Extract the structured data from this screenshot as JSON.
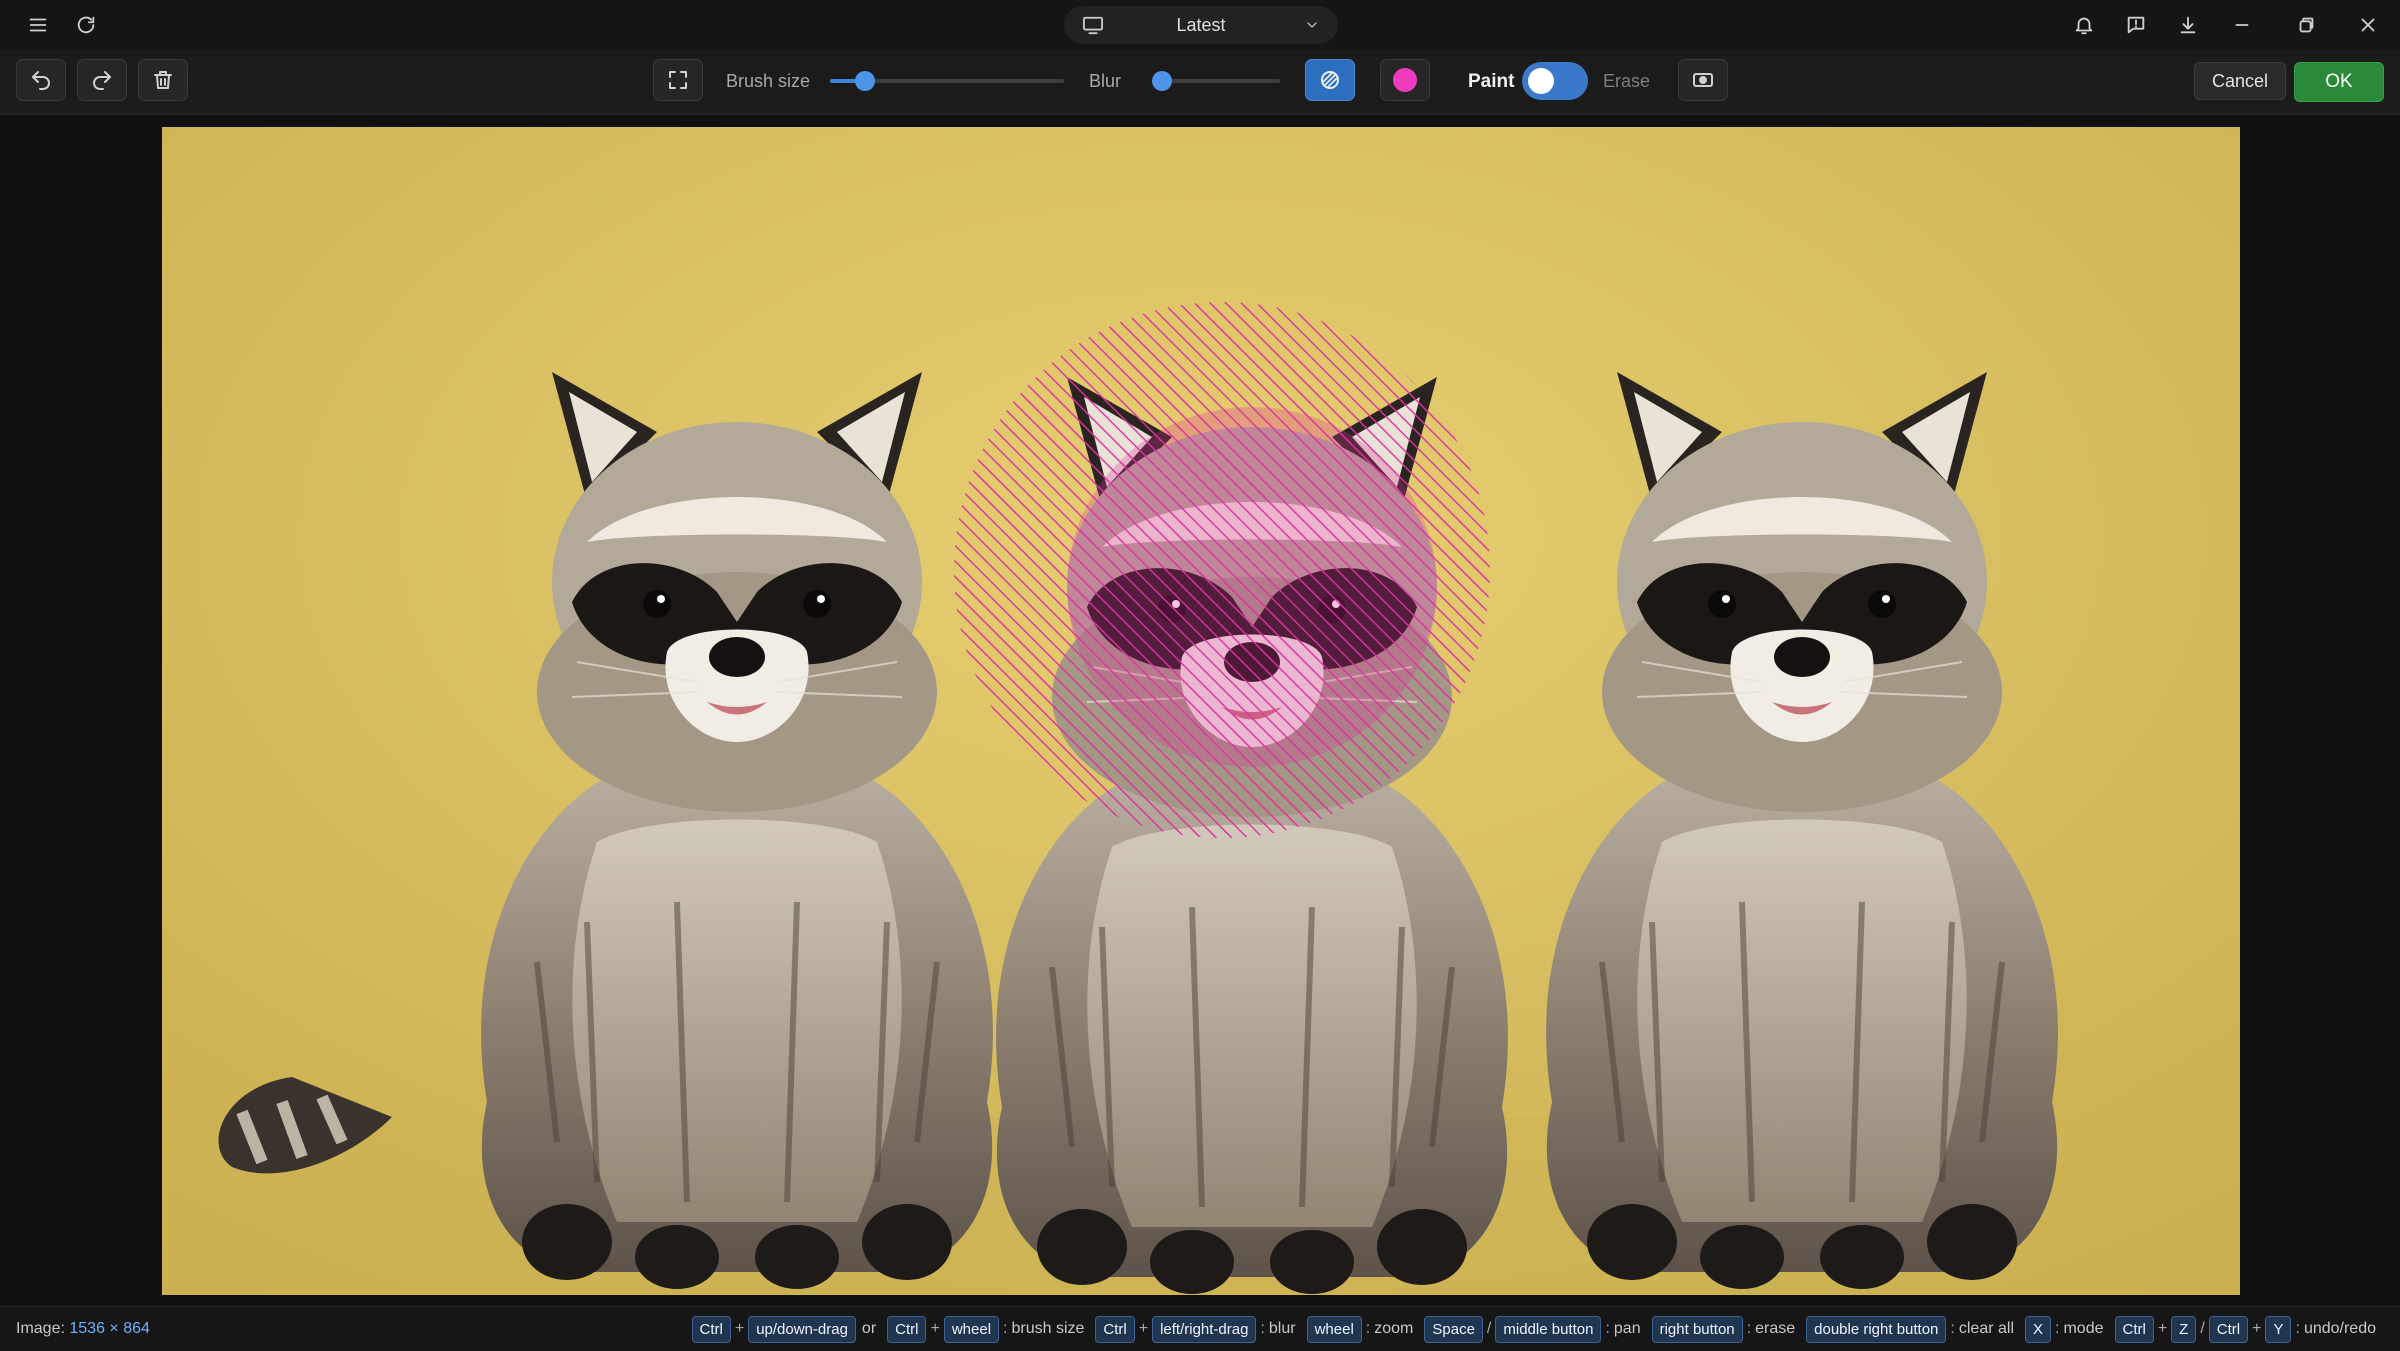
{
  "titlebar": {
    "version_label": "Latest",
    "icons": [
      "menu-icon",
      "refresh-icon",
      "monitor-icon",
      "chevron-down-icon",
      "bell-icon",
      "feedback-icon",
      "download-icon",
      "minimize-icon",
      "restore-icon",
      "close-icon"
    ]
  },
  "toolbar": {
    "brush_size_label": "Brush size",
    "brush_size_value": 0.15,
    "blur_label": "Blur",
    "blur_value": 0.0,
    "mask_color": "#ee3bbd",
    "paint_label": "Paint",
    "erase_label": "Erase",
    "mode": "paint",
    "cancel_label": "Cancel",
    "ok_label": "OK",
    "icons": [
      "undo-icon",
      "redo-icon",
      "trash-icon",
      "fullscreen-icon",
      "mask-pattern-icon",
      "color-swatch-icon",
      "invert-mask-icon"
    ]
  },
  "canvas": {
    "image_description": "Three raccoons sitting in front of a yellow backdrop; center raccoon's head covered by a pink hatched mask circle",
    "mask_color": "#e0309f"
  },
  "status": {
    "image_label": "Image:",
    "image_size": "1536 × 864",
    "hints": [
      {
        "keys": [
          "Ctrl",
          "up/down-drag"
        ],
        "join": [
          "+"
        ],
        "tail_sep": "or"
      },
      {
        "keys": [
          "Ctrl",
          "wheel"
        ],
        "join": [
          "+"
        ],
        "desc": "brush size"
      },
      {
        "keys": [
          "Ctrl",
          "left/right-drag"
        ],
        "join": [
          "+"
        ],
        "desc": "blur"
      },
      {
        "keys": [
          "wheel"
        ],
        "desc": "zoom"
      },
      {
        "keys": [
          "Space",
          "middle button"
        ],
        "join": [
          "/"
        ],
        "desc": "pan"
      },
      {
        "keys": [
          "right button"
        ],
        "desc": "erase"
      },
      {
        "keys": [
          "double right button"
        ],
        "desc": "clear all"
      },
      {
        "keys": [
          "X"
        ],
        "desc": "mode"
      },
      {
        "keys": [
          "Ctrl",
          "Z",
          "Ctrl",
          "Y"
        ],
        "join": [
          "+",
          "/",
          "+"
        ],
        "desc": "undo/redo"
      }
    ]
  }
}
